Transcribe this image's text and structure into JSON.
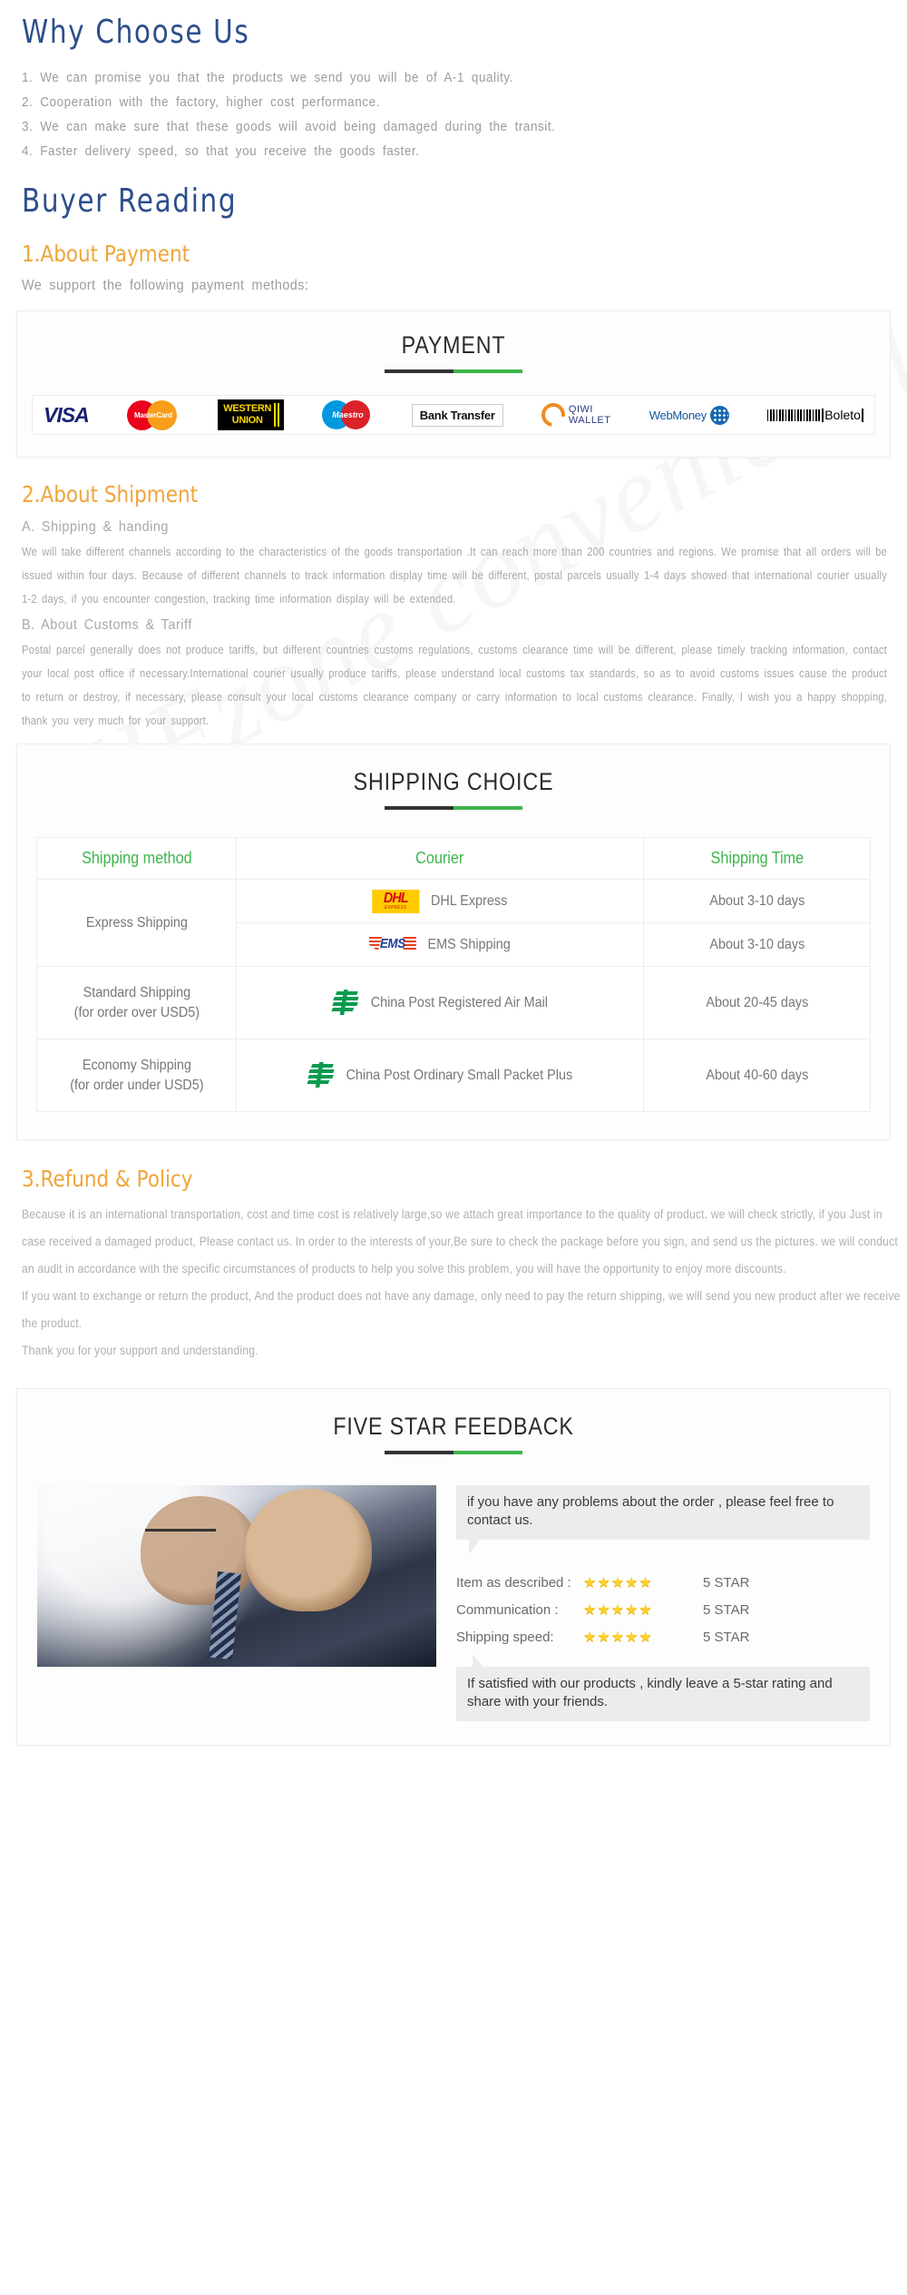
{
  "watermark": "HFzone convenient life store",
  "why_choose": {
    "title": "Why Choose Us",
    "items": [
      "1. We can promise you that the products we send you will be of A-1 quality.",
      "2. Cooperation with the factory, higher cost performance.",
      "3. We can make sure that these goods will avoid being damaged during the transit.",
      "4. Faster delivery speed, so that you receive the goods faster."
    ]
  },
  "buyer_reading": {
    "title": "Buyer  Reading"
  },
  "payment": {
    "heading": "1.About Payment",
    "lead": "We support the following payment methods:",
    "card_title": "PAYMENT",
    "logos": [
      {
        "name": "visa-logo",
        "label": "VISA"
      },
      {
        "name": "mastercard-logo",
        "label": "MasterCard"
      },
      {
        "name": "western-union-logo",
        "label_line1": "WESTERN",
        "label_line2": "UNION"
      },
      {
        "name": "maestro-logo",
        "label": "Maestro"
      },
      {
        "name": "bank-transfer-logo",
        "label": "Bank Transfer"
      },
      {
        "name": "qiwi-wallet-logo",
        "label_line1": "QIWI",
        "label_line2": "WALLET"
      },
      {
        "name": "webmoney-logo",
        "label": "WebMoney"
      },
      {
        "name": "boleto-logo",
        "label": "Boleto"
      }
    ]
  },
  "shipment": {
    "heading": "2.About Shipment",
    "sub_a": "A. Shipping & handing",
    "para_a": "We will take different channels according to the characteristics of the goods transportation .It can reach more than 200 countries and regions. We promise that all orders will be issued within four days. Because of different channels to track information display time will be different, postal parcels usually 1-4 days showed that international courier usually 1-2 days, if you encounter congestion, tracking time information display will be extended.",
    "sub_b": "B. About Customs & Tariff",
    "para_b": "Postal parcel generally does not produce tariffs, but different countries customs regulations, customs clearance time will be different, please timely tracking information, contact your local post office if necessary.International courier usually produce tariffs, please understand local customs tax standards, so as to avoid customs issues cause the product to return or destroy, if necessary, please consult your local customs clearance company or carry information to local customs clearance. Finally, I wish you a happy shopping, thank you very much for your support.",
    "table_title": "SHIPPING CHOICE",
    "table": {
      "headers": [
        "Shipping method",
        "Courier",
        "Shipping Time"
      ],
      "rows": [
        {
          "method": "Express Shipping",
          "method_note": "",
          "couriers": [
            {
              "logo": "dhl-logo",
              "logo_text": "DHL",
              "logo_sub": "EXPRESS",
              "label": "DHL Express",
              "time": "About 3-10 days"
            },
            {
              "logo": "ems-logo",
              "logo_text": "EMS",
              "label": "EMS Shipping",
              "time": "About 3-10 days"
            }
          ]
        },
        {
          "method": "Standard Shipping",
          "method_note": "(for order over USD5)",
          "couriers": [
            {
              "logo": "china-post-logo",
              "label": "China Post Registered Air Mail",
              "time": "About 20-45 days"
            }
          ]
        },
        {
          "method": "Economy Shipping",
          "method_note": "(for order under USD5)",
          "couriers": [
            {
              "logo": "china-post-logo",
              "label": "China Post Ordinary Small Packet Plus",
              "time": "About 40-60 days"
            }
          ]
        }
      ]
    }
  },
  "refund": {
    "heading": "3.Refund & Policy",
    "paragraphs": [
      "Because it is an international transportation, cost and time cost is relatively large,so we attach great importance to the quality of product. we will check strictly, if you Just in case received a damaged product, Please contact us. In order to the interests of your,Be sure to check the package before you sign, and send us the pictures. we will conduct an audit in accordance with the specific circumstances of products to help you solve this problem, you will have the opportunity to enjoy more discounts.",
      "If you want to exchange or return the product, And the product does not have any damage, only need to pay the return shipping, we will send you new product after we receive the product.",
      "Thank you for your support and understanding."
    ]
  },
  "feedback": {
    "card_title": "FIVE STAR FEEDBACK",
    "bubble_top": "if you have any problems about the order , please feel free to contact us.",
    "ratings": [
      {
        "label": "Item as described :",
        "stars": "★★★★★",
        "value": "5 STAR"
      },
      {
        "label": "Communication :",
        "stars": "★★★★★",
        "value": "5 STAR"
      },
      {
        "label": "Shipping speed:",
        "stars": "★★★★★",
        "value": "5 STAR"
      }
    ],
    "bubble_bottom": "If satisfied with our products ,  kindly leave a 5-star rating and share with your friends."
  },
  "colors": {
    "blue_heading": "#2d4e8c",
    "orange_heading": "#efa53b",
    "green_accent": "#3cb54a",
    "body_text": "#a8a8a8"
  }
}
